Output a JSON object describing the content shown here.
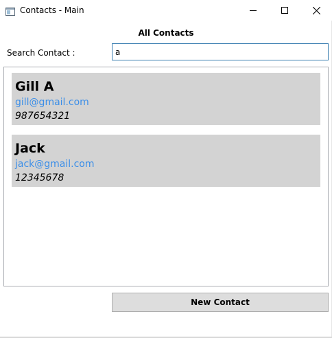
{
  "window": {
    "title": "Contacts - Main",
    "app_icon": "window-app-icon",
    "controls": {
      "minimize_icon": "minimize-icon",
      "maximize_icon": "maximize-icon",
      "close_icon": "close-icon"
    }
  },
  "main": {
    "heading": "All Contacts",
    "search": {
      "label": "Search Contact :",
      "value": "a"
    },
    "contacts": [
      {
        "name": "Gill A",
        "email": "gill@gmail.com",
        "phone": "987654321"
      },
      {
        "name": "Jack",
        "email": "jack@gmail.com",
        "phone": "12345678"
      }
    ],
    "new_contact_label": "New Contact"
  },
  "colors": {
    "card_background": "#d3d3d3",
    "email_text": "#3b8ee8",
    "input_focus_border": "#3c7fb1",
    "button_background": "#dddddd"
  }
}
